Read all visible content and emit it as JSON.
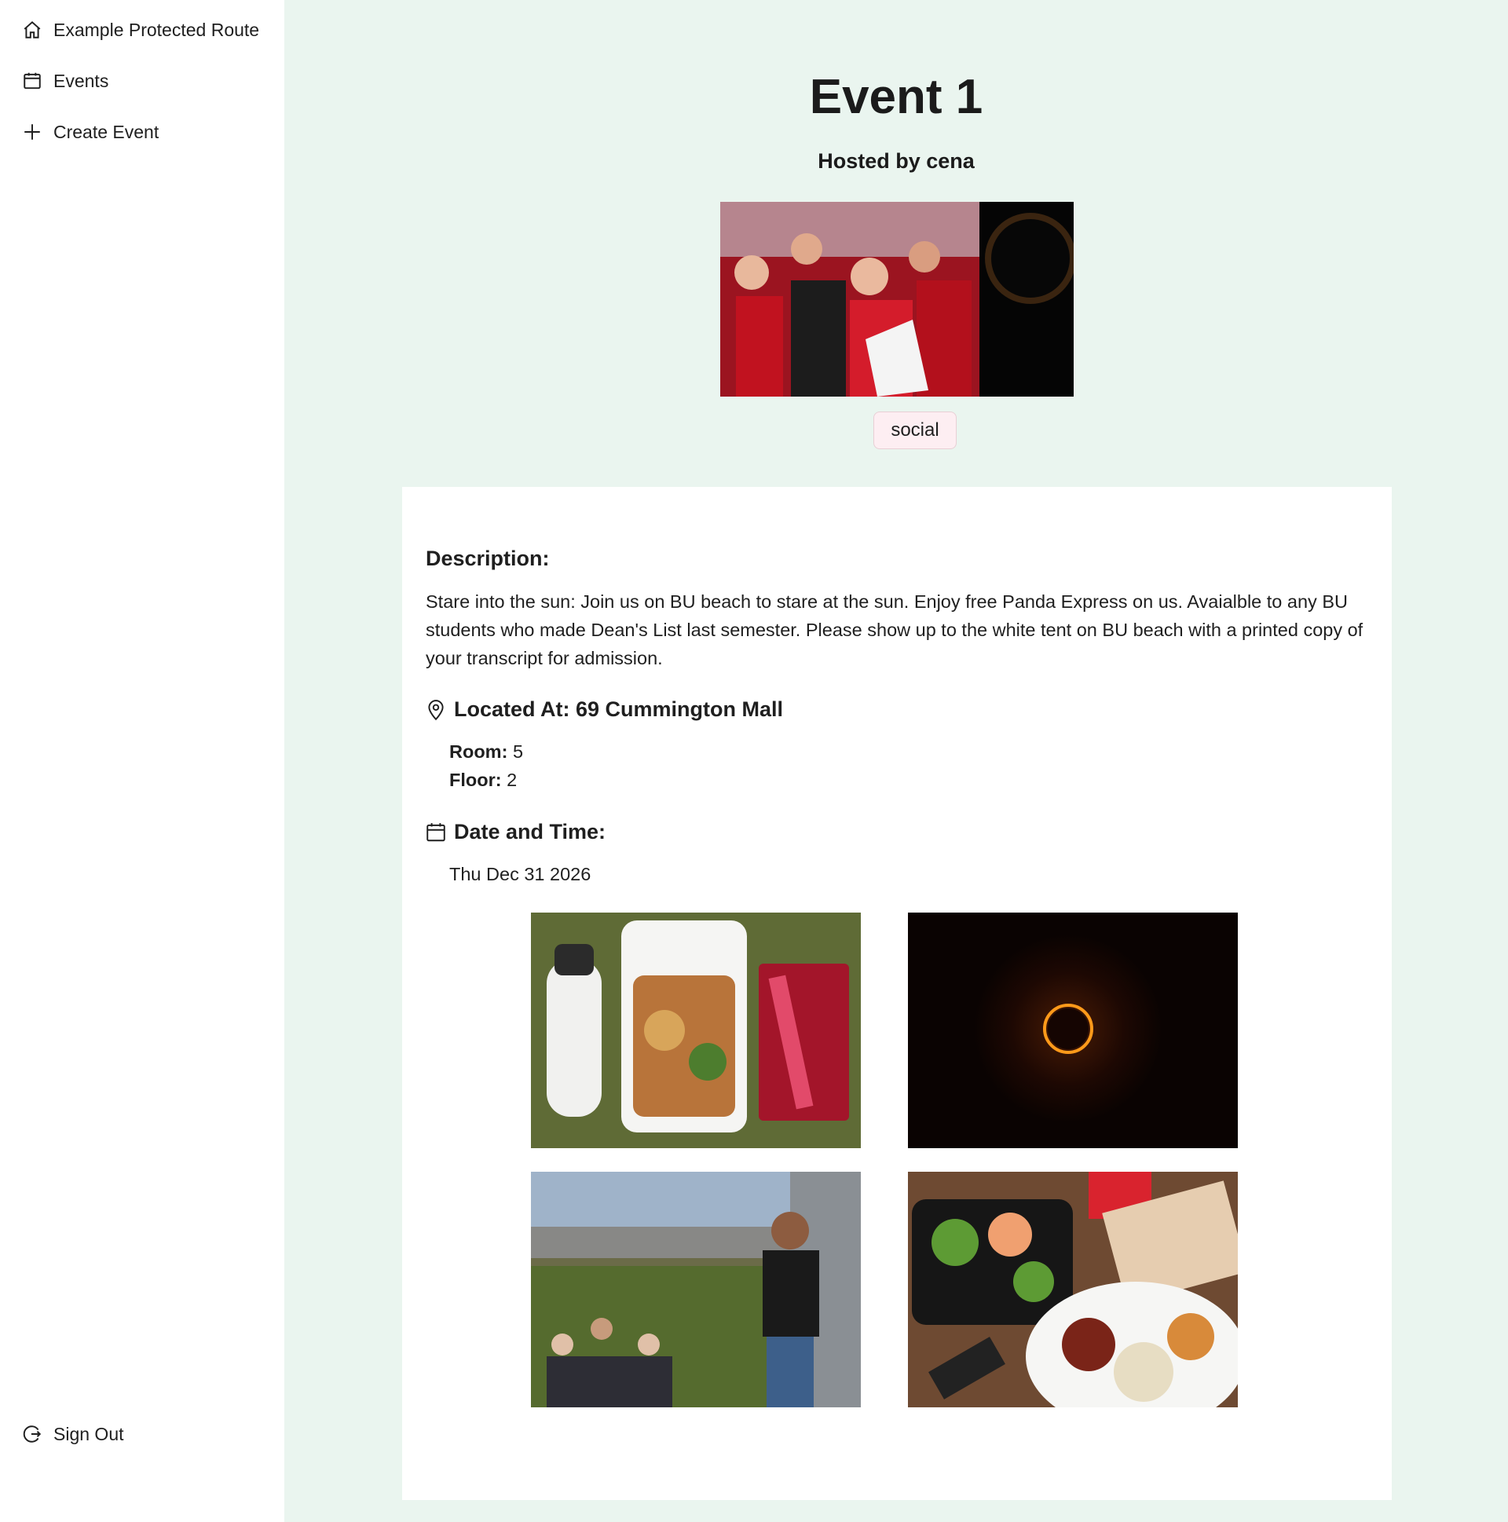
{
  "sidebar": {
    "items": [
      {
        "label": "Example Protected Route",
        "icon": "home-icon"
      },
      {
        "label": "Events",
        "icon": "calendar-icon"
      },
      {
        "label": "Create Event",
        "icon": "plus-icon"
      }
    ],
    "sign_out": {
      "label": "Sign Out",
      "icon": "sign-out-icon"
    }
  },
  "event": {
    "title": "Event 1",
    "host": "Hosted by cena",
    "tag": "social",
    "description_heading": "Description:",
    "description": "Stare into the sun: Join us on BU beach to stare at the sun. Enjoy free Panda Express on us. Avaialble to any BU students who made Dean's List last semester. Please show up to the white tent on BU beach with a printed copy of your transcript for admission.",
    "location_heading": "Located At: 69 Cummington Mall",
    "room_label": "Room:",
    "room_value": "5",
    "floor_label": "Floor:",
    "floor_value": "2",
    "datetime_heading": "Date and Time:",
    "date": "Thu Dec 31 2026"
  },
  "colors": {
    "page_background": "#eaf5ef",
    "card_background": "#ffffff",
    "tag_background": "#fdeef2",
    "text": "#1f1f1f"
  }
}
